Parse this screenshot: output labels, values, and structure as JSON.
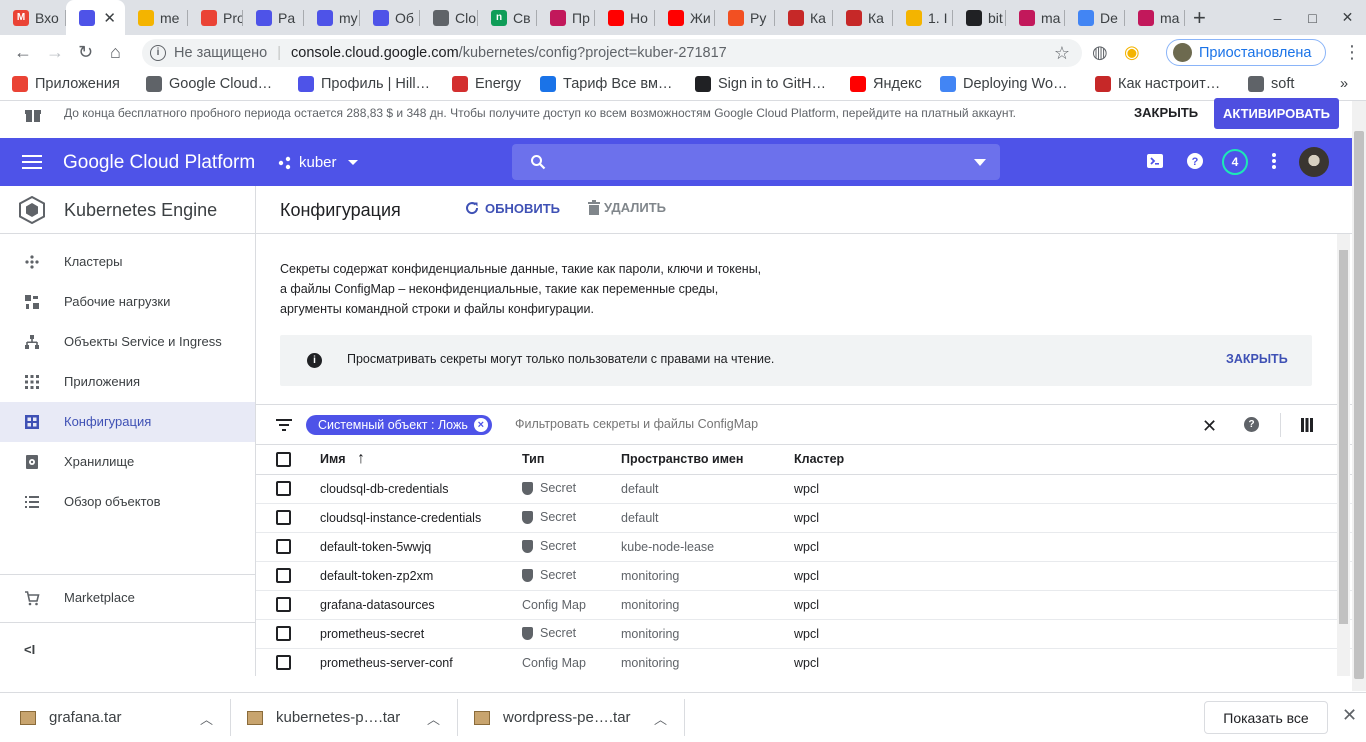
{
  "browser": {
    "tabs": [
      {
        "label": "Вхо",
        "color": "#ea4335",
        "glyph": "M"
      },
      {
        "label": "",
        "color": "#4e53e8",
        "glyph": "",
        "active": true
      },
      {
        "label": "me",
        "color": "#f4b400",
        "glyph": ""
      },
      {
        "label": "Pro",
        "color": "#ea4335",
        "glyph": ""
      },
      {
        "label": "Pa",
        "color": "#4e53e8",
        "glyph": ""
      },
      {
        "label": "my",
        "color": "#4e53e8",
        "glyph": ""
      },
      {
        "label": "Об",
        "color": "#4e53e8",
        "glyph": ""
      },
      {
        "label": "Clo",
        "color": "#5f6368",
        "glyph": ""
      },
      {
        "label": "Св",
        "color": "#0f9d58",
        "glyph": "n"
      },
      {
        "label": "Пр",
        "color": "#c2185b",
        "glyph": ""
      },
      {
        "label": "Но",
        "color": "#ff0000",
        "glyph": ""
      },
      {
        "label": "Жи",
        "color": "#ff0000",
        "glyph": ""
      },
      {
        "label": "Ру",
        "color": "#f25022",
        "glyph": ""
      },
      {
        "label": "Ка",
        "color": "#c62828",
        "glyph": ""
      },
      {
        "label": "Ка",
        "color": "#c62828",
        "glyph": ""
      },
      {
        "label": "1. I",
        "color": "#f4b400",
        "glyph": ""
      },
      {
        "label": "bit",
        "color": "#202124",
        "glyph": ""
      },
      {
        "label": "ma",
        "color": "#c2185b",
        "glyph": ""
      },
      {
        "label": "De",
        "color": "#4285f4",
        "glyph": ""
      },
      {
        "label": "ma",
        "color": "#c2185b",
        "glyph": ""
      }
    ],
    "new_tab": "+",
    "window_controls": [
      "–",
      "□",
      "✕"
    ],
    "omnibox": {
      "security": "Не защищено",
      "url_host": "console.cloud.google.com",
      "url_path": "/kubernetes/config?project=kuber-271817"
    },
    "profile_status": "Приостановлена",
    "bookmarks": [
      {
        "label": "Приложения",
        "color": "#ea4335"
      },
      {
        "label": "Google Cloud…",
        "color": "#5f6368"
      },
      {
        "label": "Профиль | Hill…",
        "color": "#4e53e8"
      },
      {
        "label": "Energy",
        "color": "#d32f2f"
      },
      {
        "label": "Тариф Все вм…",
        "color": "#1a73e8"
      },
      {
        "label": "Sign in to GitH…",
        "color": "#202124"
      },
      {
        "label": "Яндекс",
        "color": "#ff0000"
      },
      {
        "label": "Deploying Wo…",
        "color": "#4285f4"
      },
      {
        "label": "Как настроит…",
        "color": "#c62828"
      },
      {
        "label": "soft",
        "color": "#5f6368"
      }
    ],
    "bookmarks_more": "»"
  },
  "promo": {
    "text": "До конца бесплатного пробного периода остается 288,83 $ и 348 дн. Чтобы получите доступ ко всем возможностям Google Cloud Platform, перейдите на платный аккаунт.",
    "close_label": "ЗАКРЫТЬ",
    "activate_label": "АКТИВИРОВАТЬ"
  },
  "header": {
    "brand": "Google Cloud Platform",
    "project": "kuber",
    "notifications": "4",
    "accent": "#4e53e8"
  },
  "sidebar": {
    "title": "Kubernetes Engine",
    "items": [
      {
        "label": "Кластеры",
        "icon": "clusters-icon"
      },
      {
        "label": "Рабочие нагрузки",
        "icon": "workloads-icon"
      },
      {
        "label": "Объекты Service и Ingress",
        "icon": "services-icon"
      },
      {
        "label": "Приложения",
        "icon": "applications-icon"
      },
      {
        "label": "Конфигурация",
        "icon": "configuration-icon",
        "selected": true
      },
      {
        "label": "Хранилище",
        "icon": "storage-icon"
      },
      {
        "label": "Обзор объектов",
        "icon": "object-browser-icon"
      }
    ],
    "marketplace": "Marketplace",
    "collapse": "<I"
  },
  "main": {
    "title": "Конфигурация",
    "refresh_label": "ОБНОВИТЬ",
    "delete_label": "УДАЛИТЬ",
    "description": [
      "Секреты содержат конфиденциальные данные, такие как пароли, ключи и токены,",
      "а файлы ConfigMap – неконфиденциальные, такие как переменные среды,",
      "аргументы командной строки и файлы конфигурации."
    ],
    "info": {
      "text": "Просматривать секреты могут только пользователи с правами на чтение.",
      "close_label": "ЗАКРЫТЬ"
    },
    "filter": {
      "chip": "Системный объект : Ложь",
      "placeholder": "Фильтровать секреты и файлы ConfigMap"
    },
    "table": {
      "columns": [
        "Имя",
        "Тип",
        "Пространство имен",
        "Кластер"
      ],
      "sort_indicator": "↑",
      "rows": [
        {
          "name": "cloudsql-db-credentials",
          "type": "Secret",
          "namespace": "default",
          "cluster": "wpcl"
        },
        {
          "name": "cloudsql-instance-credentials",
          "type": "Secret",
          "namespace": "default",
          "cluster": "wpcl"
        },
        {
          "name": "default-token-5wwjq",
          "type": "Secret",
          "namespace": "kube-node-lease",
          "cluster": "wpcl"
        },
        {
          "name": "default-token-zp2xm",
          "type": "Secret",
          "namespace": "monitoring",
          "cluster": "wpcl"
        },
        {
          "name": "grafana-datasources",
          "type": "Config Map",
          "namespace": "monitoring",
          "cluster": "wpcl"
        },
        {
          "name": "prometheus-secret",
          "type": "Secret",
          "namespace": "monitoring",
          "cluster": "wpcl"
        },
        {
          "name": "prometheus-server-conf",
          "type": "Config Map",
          "namespace": "monitoring",
          "cluster": "wpcl"
        }
      ]
    }
  },
  "downloads": {
    "items": [
      "grafana.tar",
      "kubernetes-p….tar",
      "wordpress-pe….tar"
    ],
    "show_all": "Показать все"
  }
}
